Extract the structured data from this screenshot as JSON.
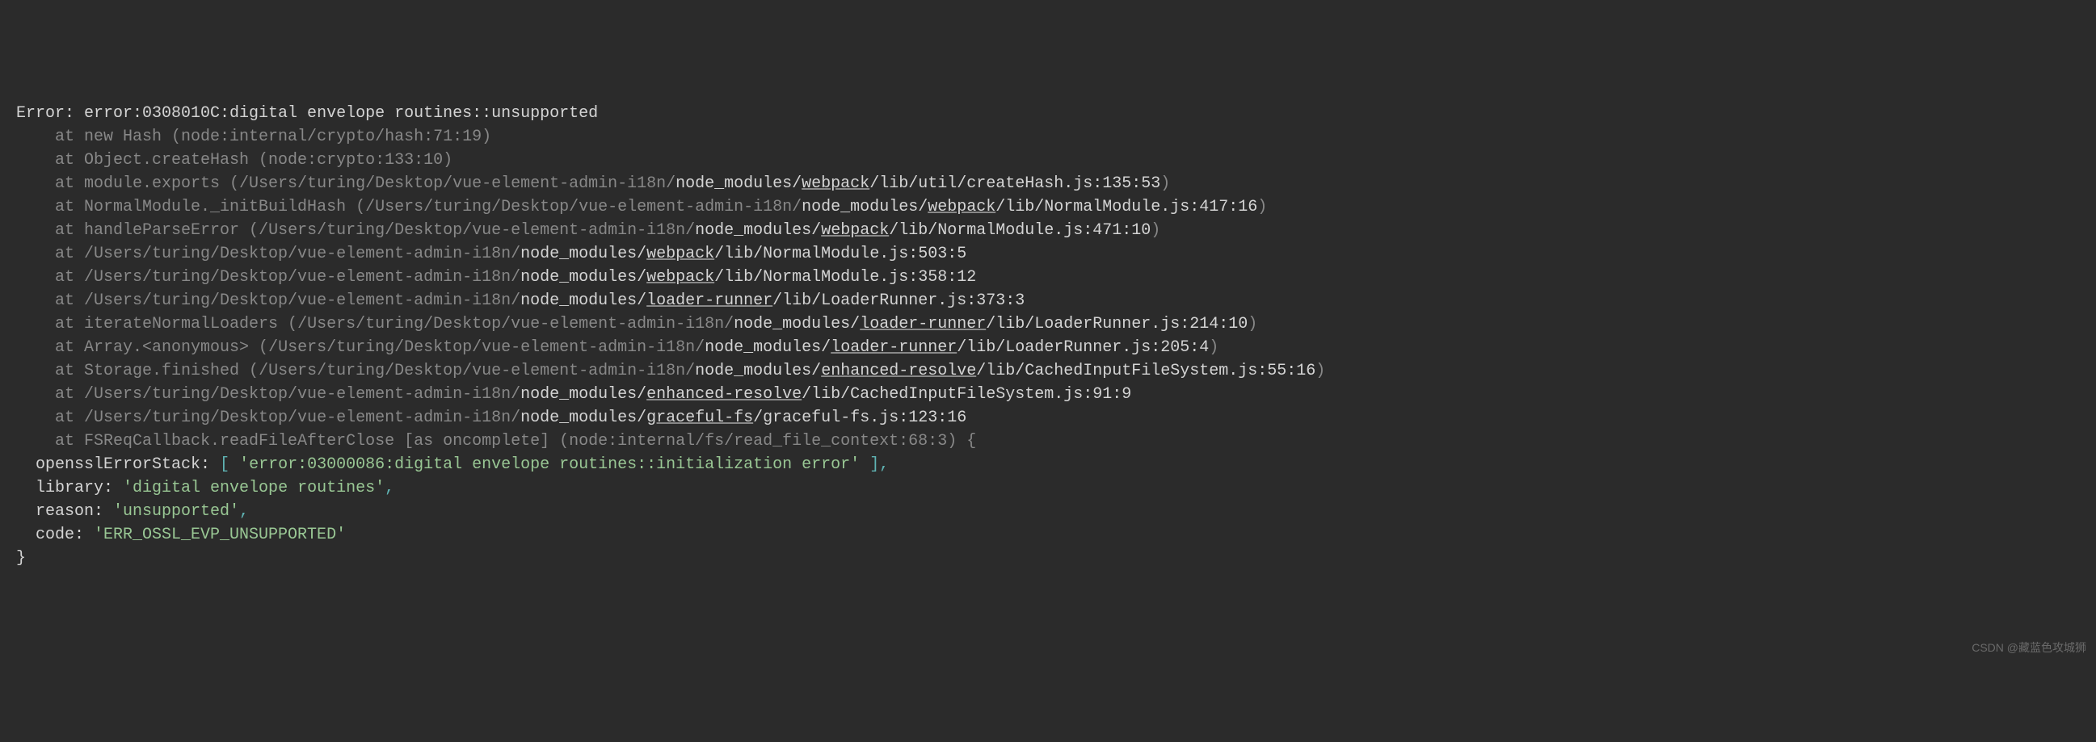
{
  "error": {
    "prefix": "Error: ",
    "message": "error:0308010C:digital envelope routines::unsupported",
    "stack": [
      {
        "at": "    at ",
        "func": "new Hash (node:internal/crypto/hash:71:19)"
      },
      {
        "at": "    at ",
        "func": "Object.createHash (node:crypto:133:10)"
      },
      {
        "at": "    at ",
        "func": "module.exports (",
        "path_grey": "/Users/turing/Desktop/vue-element-admin-i18n/",
        "path_white1": "node_modules/",
        "link1": "webpack",
        "path_white2": "/lib/util/createHash.js:135:53",
        "close": ")"
      },
      {
        "at": "    at ",
        "func": "NormalModule._initBuildHash (",
        "path_grey": "/Users/turing/Desktop/vue-element-admin-i18n/",
        "path_white1": "node_modules/",
        "link1": "webpack",
        "path_white2": "/lib/NormalModule.js:417:16",
        "close": ")"
      },
      {
        "at": "    at ",
        "func": "handleParseError (",
        "path_grey": "/Users/turing/Desktop/vue-element-admin-i18n/",
        "path_white1": "node_modules/",
        "link1": "webpack",
        "path_white2": "/lib/NormalModule.js:471:10",
        "close": ")"
      },
      {
        "at": "    at ",
        "path_grey": "/Users/turing/Desktop/vue-element-admin-i18n/",
        "path_white1": "node_modules/",
        "link1": "webpack",
        "path_white2": "/lib/NormalModule.js:503:5"
      },
      {
        "at": "    at ",
        "path_grey": "/Users/turing/Desktop/vue-element-admin-i18n/",
        "path_white1": "node_modules/",
        "link1": "webpack",
        "path_white2": "/lib/NormalModule.js:358:12"
      },
      {
        "at": "    at ",
        "path_grey": "/Users/turing/Desktop/vue-element-admin-i18n/",
        "path_white1": "node_modules/",
        "link1": "loader-runner",
        "path_white2": "/lib/LoaderRunner.js:373:3"
      },
      {
        "at": "    at ",
        "func": "iterateNormalLoaders (",
        "path_grey": "/Users/turing/Desktop/vue-element-admin-i18n/",
        "path_white1": "node_modules/",
        "link1": "loader-runner",
        "path_white2": "/lib/LoaderRunner.js:214:10",
        "close": ")"
      },
      {
        "at": "    at ",
        "func": "Array.<anonymous> (",
        "path_grey": "/Users/turing/Desktop/vue-element-admin-i18n/",
        "path_white1": "node_modules/",
        "link1": "loader-runner",
        "path_white2": "/lib/LoaderRunner.js:205:4",
        "close": ")"
      },
      {
        "at": "    at ",
        "func": "Storage.finished (",
        "path_grey": "/Users/turing/Desktop/vue-element-admin-i18n/",
        "path_white1": "node_modules/",
        "link1": "enhanced-resolve",
        "path_white2": "/lib/CachedInputFileSystem.js:55:16",
        "close": ")"
      },
      {
        "at": "    at ",
        "path_grey": "/Users/turing/Desktop/vue-element-admin-i18n/",
        "path_white1": "node_modules/",
        "link1": "enhanced-resolve",
        "path_white2": "/lib/CachedInputFileSystem.js:91:9"
      },
      {
        "at": "    at ",
        "path_grey": "/Users/turing/Desktop/vue-element-admin-i18n/",
        "path_white1": "node_modules/",
        "link1": "graceful-fs",
        "path_white2": "/graceful-fs.js:123:16"
      },
      {
        "at": "    at ",
        "func": "FSReqCallback.readFileAfterClose [as oncomplete] (node:internal/fs/read_file_context:68:3) {"
      }
    ],
    "props": {
      "opensslErrorStack_key": "  opensslErrorStack: ",
      "opensslErrorStack_bracket_open": "[ ",
      "opensslErrorStack_value": "'error:03000086:digital envelope routines::initialization error'",
      "opensslErrorStack_bracket_close": " ],",
      "library_key": "  library: ",
      "library_value": "'digital envelope routines'",
      "comma1": ",",
      "reason_key": "  reason: ",
      "reason_value": "'unsupported'",
      "comma2": ",",
      "code_key": "  code: ",
      "code_value": "'ERR_OSSL_EVP_UNSUPPORTED'",
      "close_brace": "}"
    }
  },
  "watermark": "CSDN @藏蓝色攻城狮"
}
